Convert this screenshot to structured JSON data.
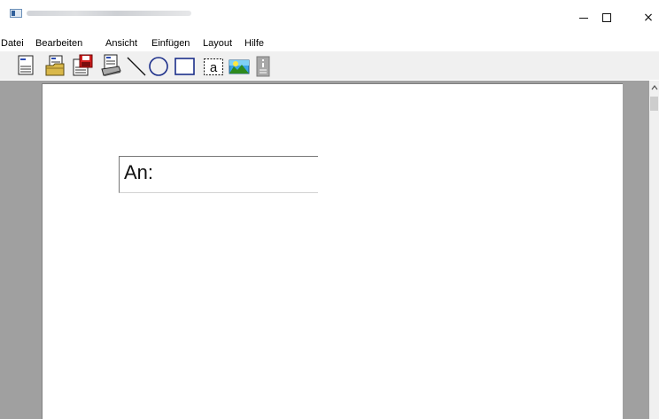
{
  "window": {
    "controls": {
      "minimize_icon": "minimize-icon",
      "maximize_icon": "maximize-icon",
      "close_label": "×"
    }
  },
  "menu": {
    "items": [
      {
        "label": "Datei"
      },
      {
        "label": "Bearbeiten"
      },
      {
        "label": "Ansicht"
      },
      {
        "label": "Einfügen"
      },
      {
        "label": "Layout"
      },
      {
        "label": "Hilfe"
      }
    ]
  },
  "toolbar": {
    "tools": [
      {
        "name": "new-document-icon"
      },
      {
        "name": "open-folder-icon"
      },
      {
        "name": "save-icon"
      },
      {
        "name": "print-icon"
      },
      {
        "name": "line-tool-icon"
      },
      {
        "name": "ellipse-tool-icon"
      },
      {
        "name": "rectangle-tool-icon"
      },
      {
        "name": "text-tool-icon",
        "label": "a"
      },
      {
        "name": "image-tool-icon"
      },
      {
        "name": "info-icon"
      }
    ]
  },
  "document": {
    "address_field_text": "An:"
  },
  "colors": {
    "workspace": "#a0a0a0",
    "toolbar": "#f0f0f0",
    "save_red": "#d42020",
    "ellipse_blue": "#1c2f8a"
  }
}
